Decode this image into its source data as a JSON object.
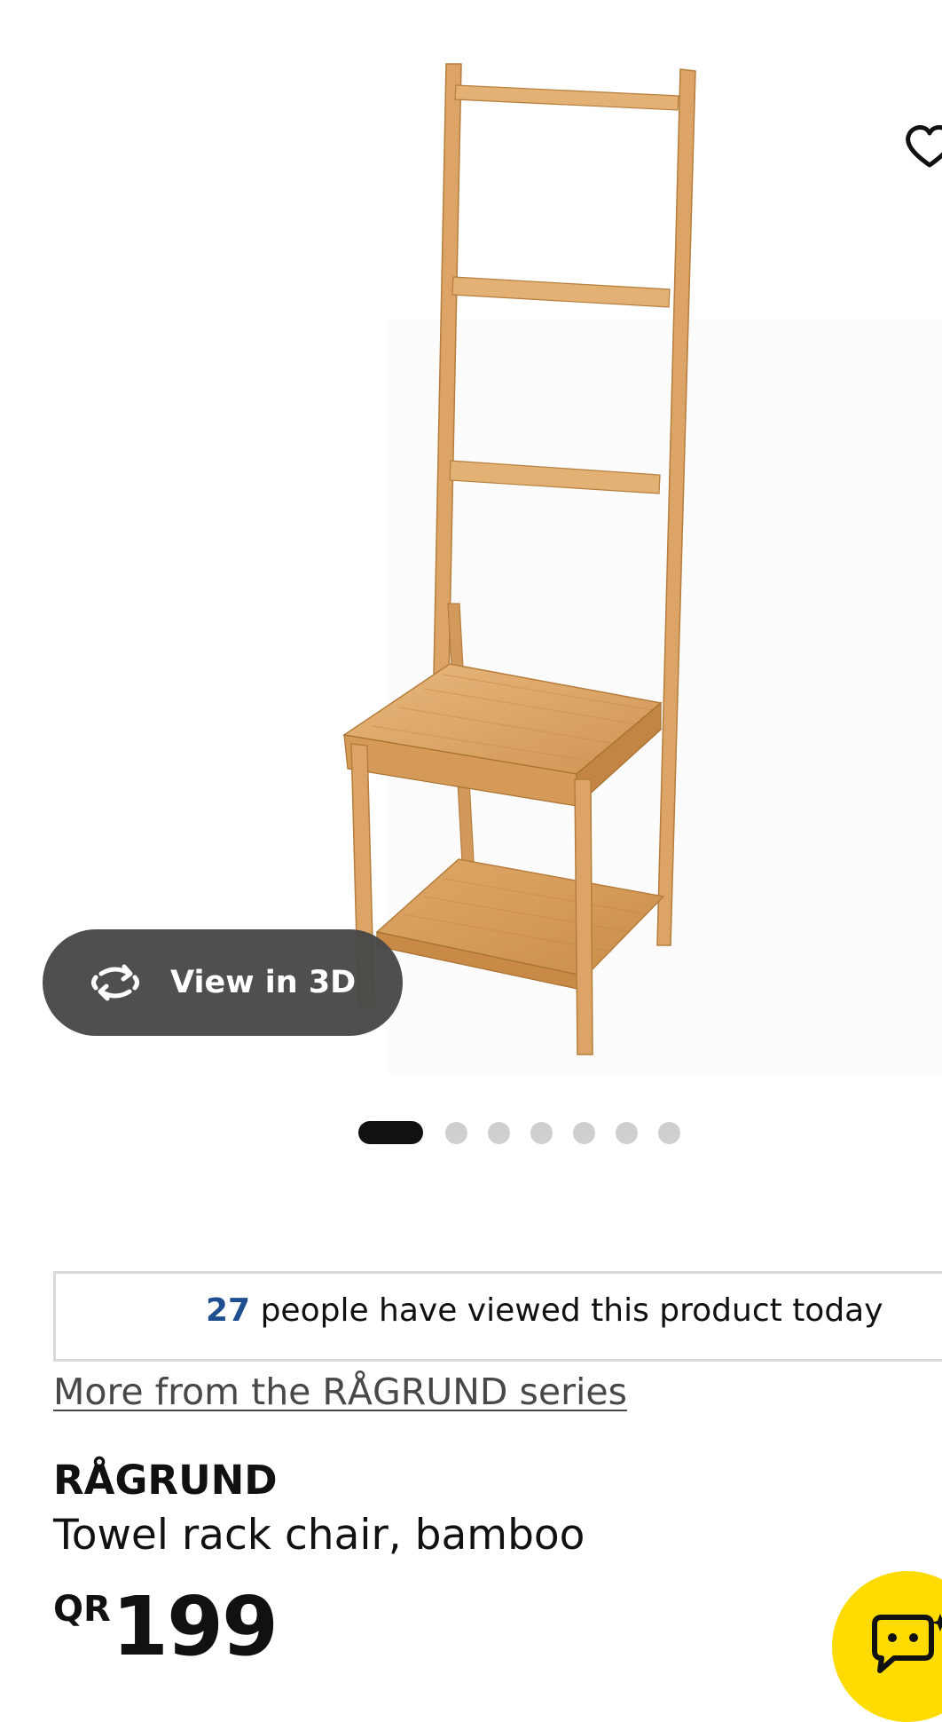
{
  "product_image": {
    "alt": "RÅGRUND Towel rack chair, bamboo"
  },
  "view3d": {
    "label": "View in 3D",
    "icon": "rotate-3d-icon"
  },
  "favourite": {
    "icon": "heart-outline-icon"
  },
  "carousel": {
    "total": 7,
    "active_index": 0
  },
  "views_notice": {
    "count": "27",
    "text": "people have viewed this product today"
  },
  "series_link": {
    "label": "More from the RÅGRUND series"
  },
  "product": {
    "name": "RÅGRUND",
    "description": "Towel rack chair, bamboo",
    "currency": "QR",
    "price": "199"
  },
  "chat": {
    "icon": "chat-assistant-icon"
  },
  "colors": {
    "bamboo_light": "#e3b173",
    "bamboo_mid": "#d9a061",
    "bamboo_dark": "#b57e3c",
    "views_count_blue": "#1f4f8f",
    "chat_yellow": "#ffdb00",
    "pill_grey": "#484848"
  }
}
